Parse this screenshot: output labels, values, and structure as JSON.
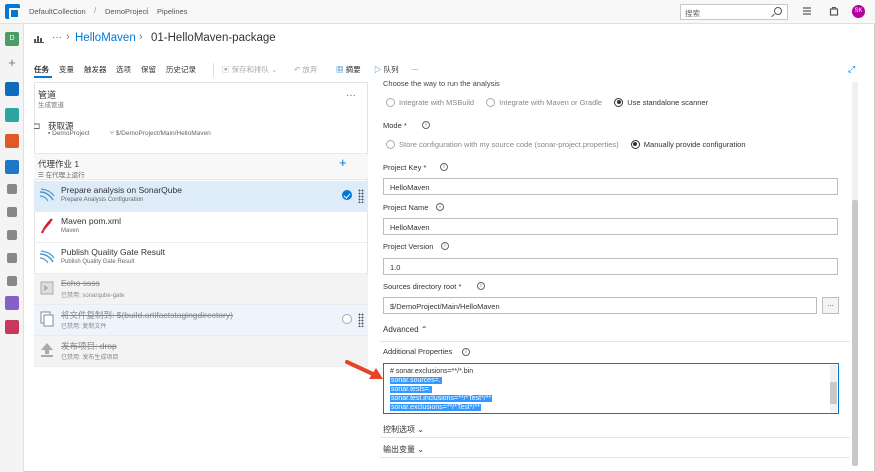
{
  "breadcrumb": [
    "DefaultCollection",
    "DemoProject",
    "Pipelines"
  ],
  "search": {
    "placeholder": "搜索"
  },
  "user": {
    "initials": "SK"
  },
  "rail": {
    "org_letter": "D"
  },
  "header": {
    "pipeline": "HelloMaven",
    "definition": "01-HelloMaven-package"
  },
  "tabs": [
    "任务",
    "变量",
    "触发器",
    "选项",
    "保留",
    "历史记录"
  ],
  "toolbar": {
    "save_queue": "保存和排队",
    "discard": "放弃",
    "summary": "摘要",
    "queue": "队列",
    "more": "..."
  },
  "pipeline": {
    "title": "管道",
    "subtitle": "生成管道",
    "source": {
      "title": "获取源",
      "project": "DemoProject",
      "path": "$/DemoProject/Main/HelloMaven"
    },
    "job": {
      "title": "代理作业 1",
      "subtitle": "在代理上运行"
    },
    "tasks": [
      {
        "name": "Prepare analysis on SonarQube",
        "sub": "Prepare Analysis Configuration",
        "state": "selected",
        "icon": "sonarqube-icon"
      },
      {
        "name": "Maven pom.xml",
        "sub": "Maven",
        "state": "normal",
        "icon": "maven-icon"
      },
      {
        "name": "Publish Quality Gate Result",
        "sub": "Publish Quality Gate Result",
        "state": "normal",
        "icon": "sonarqube-icon"
      },
      {
        "name": "Echo ssss",
        "sub": "已禁用: sonarqube-gate",
        "state": "disabled",
        "icon": "script-icon"
      },
      {
        "name": "将文件复制到: $(build.artifactstagingdirectory)",
        "sub": "已禁用: 复制文件",
        "state": "disabled",
        "icon": "copy-files-icon"
      },
      {
        "name": "发布项目: drop",
        "sub": "已禁用: 发布生成项目",
        "state": "disabled",
        "icon": "publish-artifact-icon"
      }
    ]
  },
  "form": {
    "top_cut_label": "Choose the way to run the analysis",
    "run_options": [
      "Integrate with MSBuild",
      "Integrate with Maven or Gradle",
      "Use standalone scanner"
    ],
    "run_selected": 2,
    "mode_label": "Mode *",
    "mode_options": [
      "Store configuration with my source code (sonar-project.properties)",
      "Manually provide configuration"
    ],
    "mode_selected": 1,
    "project_key_label": "Project Key *",
    "project_key": "HelloMaven",
    "project_name_label": "Project Name",
    "project_name": "HelloMaven",
    "project_version_label": "Project Version",
    "project_version": "1.0",
    "sources_root_label": "Sources directory root *",
    "sources_root": "$/DemoProject/Main/HelloMaven",
    "browse": "...",
    "advanced_label": "Advanced",
    "additional_label": "Additional Properties",
    "additional_lines": [
      {
        "text": "# sonar.exclusions=**/*.bin",
        "highlighted": false
      },
      {
        "text": "sonar.sources=.",
        "highlighted": true
      },
      {
        "text": "sonar.tests=.",
        "highlighted": true
      },
      {
        "text": "sonar.test.inclusions=**/*Test*/**",
        "highlighted": true
      },
      {
        "text": "sonar.exclusions=**/*Test*/**",
        "highlighted": true
      }
    ],
    "control_options": "控制选项",
    "output_variables": "输出变量"
  },
  "colors": {
    "accent": "#0078d4",
    "selection": "#3399ff",
    "selected_row": "#deecf9",
    "arrow": "#e8432a"
  }
}
